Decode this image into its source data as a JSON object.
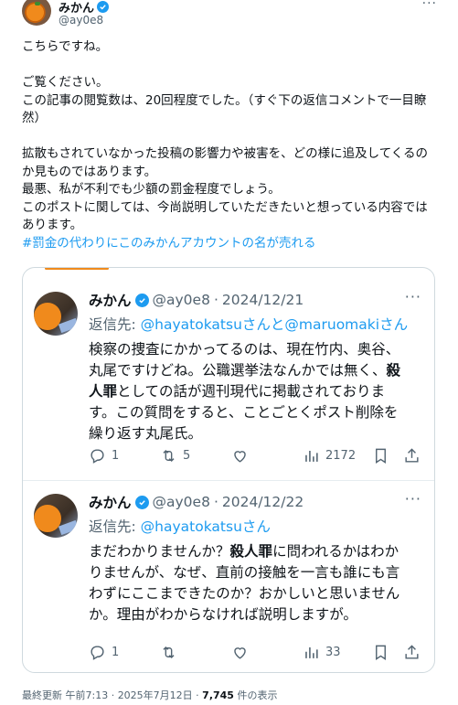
{
  "author": {
    "name": "みかん",
    "handle": "@ay0e8",
    "more": "···"
  },
  "post": {
    "line1": "こちらですね。",
    "line2": "ご覧ください。",
    "line3": "この記事の閲覧数は、20回程度でした。（すぐ下の返信コメントで一目瞭",
    "line4": "然）",
    "line5": "拡散もされていなかった投稿の影響力や被害を、どの様に追及してくるの",
    "line6": "か見ものではあります。",
    "line7": "最悪、私が不利でも少額の罰金程度でしょう。",
    "line8": "このポストに関しては、今尚説明していただきたいと想っている内容では",
    "line9": "あります。",
    "hashtag": "#罰金の代わりにこのみかんアカウントの名が売れる"
  },
  "quoted": [
    {
      "name": "みかん",
      "handle": "@ay0e8",
      "sep": "·",
      "date": "2024/12/21",
      "more": "···",
      "reply_label": "返信先: ",
      "mention1": "@hayatokatsu",
      "san1": "さんと",
      "mention2": "@maruomaki",
      "san2": "さん",
      "text_a": "検察の捜査にかかってるのは、現在竹内、奥谷、",
      "text_b": "丸尾ですけどね。公職選挙法なんかでは無く、",
      "text_bold1": "殺",
      "text_bold2": "人罪",
      "text_c": "としての話が週刊現代に掲載されておりま",
      "text_d": "す。この質問をすると、ことごとくポスト削除を",
      "text_e": "繰り返す丸尾氏。",
      "reply_count": "1",
      "repost_count": "5",
      "like_count": "",
      "views_count": "2172"
    },
    {
      "name": "みかん",
      "handle": "@ay0e8",
      "sep": "·",
      "date": "2024/12/22",
      "more": "···",
      "reply_label": "返信先: ",
      "mention1": "@hayatokatsu",
      "san1": "さん",
      "text_a": "まだわかりませんか？",
      "text_bold1": "殺人罪",
      "text_a2": "に問われるかはわか",
      "text_b": "りませんが、なぜ、直前の接触を一言も誰にも言",
      "text_c": "わずにここまできたのか？おかしいと思いません",
      "text_d": "か。理由がわからなければ説明しますが。",
      "reply_count": "1",
      "repost_count": "",
      "like_count": "",
      "views_count": "33"
    }
  ],
  "footer": {
    "prefix": "最終更新 午前7:13 · 2025年7月12日 · ",
    "views": "7,745",
    "suffix": " 件の表示"
  },
  "colors": {
    "accent": "#1d9bf0",
    "muted": "#536471",
    "text": "#0f1419",
    "border": "#cfd9de",
    "orange": "#f08a1c"
  }
}
